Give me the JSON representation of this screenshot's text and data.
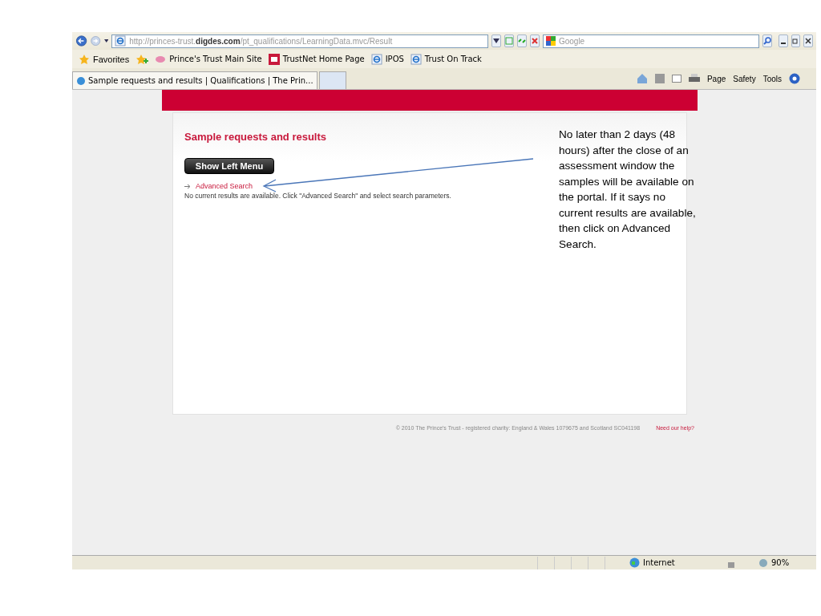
{
  "browser": {
    "address": "http://princes-trust.**digdes.com**/pt_qualifications/LearningData.mvc/Result",
    "search_placeholder": "Google",
    "favorites_label": "Favorites",
    "favorites": [
      {
        "label": "Prince's Trust Main Site",
        "kind": "flower"
      },
      {
        "label": "TrustNet Home Page",
        "kind": "trustnet"
      },
      {
        "label": "IPOS",
        "kind": "ie"
      },
      {
        "label": "Trust On Track",
        "kind": "ie"
      }
    ],
    "tabs": [
      {
        "label": "Sample requests and results | Qualifications | The Prin...",
        "selected": true
      },
      {
        "selected": false
      }
    ],
    "command_bar": [
      "Page",
      "Safety",
      "Tools"
    ],
    "status_bar": {
      "zone": "Internet",
      "zoom": "90%"
    }
  },
  "page": {
    "title": "Sample requests and results",
    "show_menu_button": "Show Left Menu",
    "advanced_search_link": "Advanced Search",
    "message": "No current results are available. Click \"Advanced Search\" and select search parameters.",
    "footer": "© 2010 The Prince's Trust - registered charity: England & Wales 1079675 and Scotland SC041198",
    "help_link": "Need our help?"
  },
  "annotation": {
    "text": "No later than 2 days (48 hours) after the close of an assessment window the samples will be available on the portal. If it says no current results are available, then click on Advanced Search."
  }
}
